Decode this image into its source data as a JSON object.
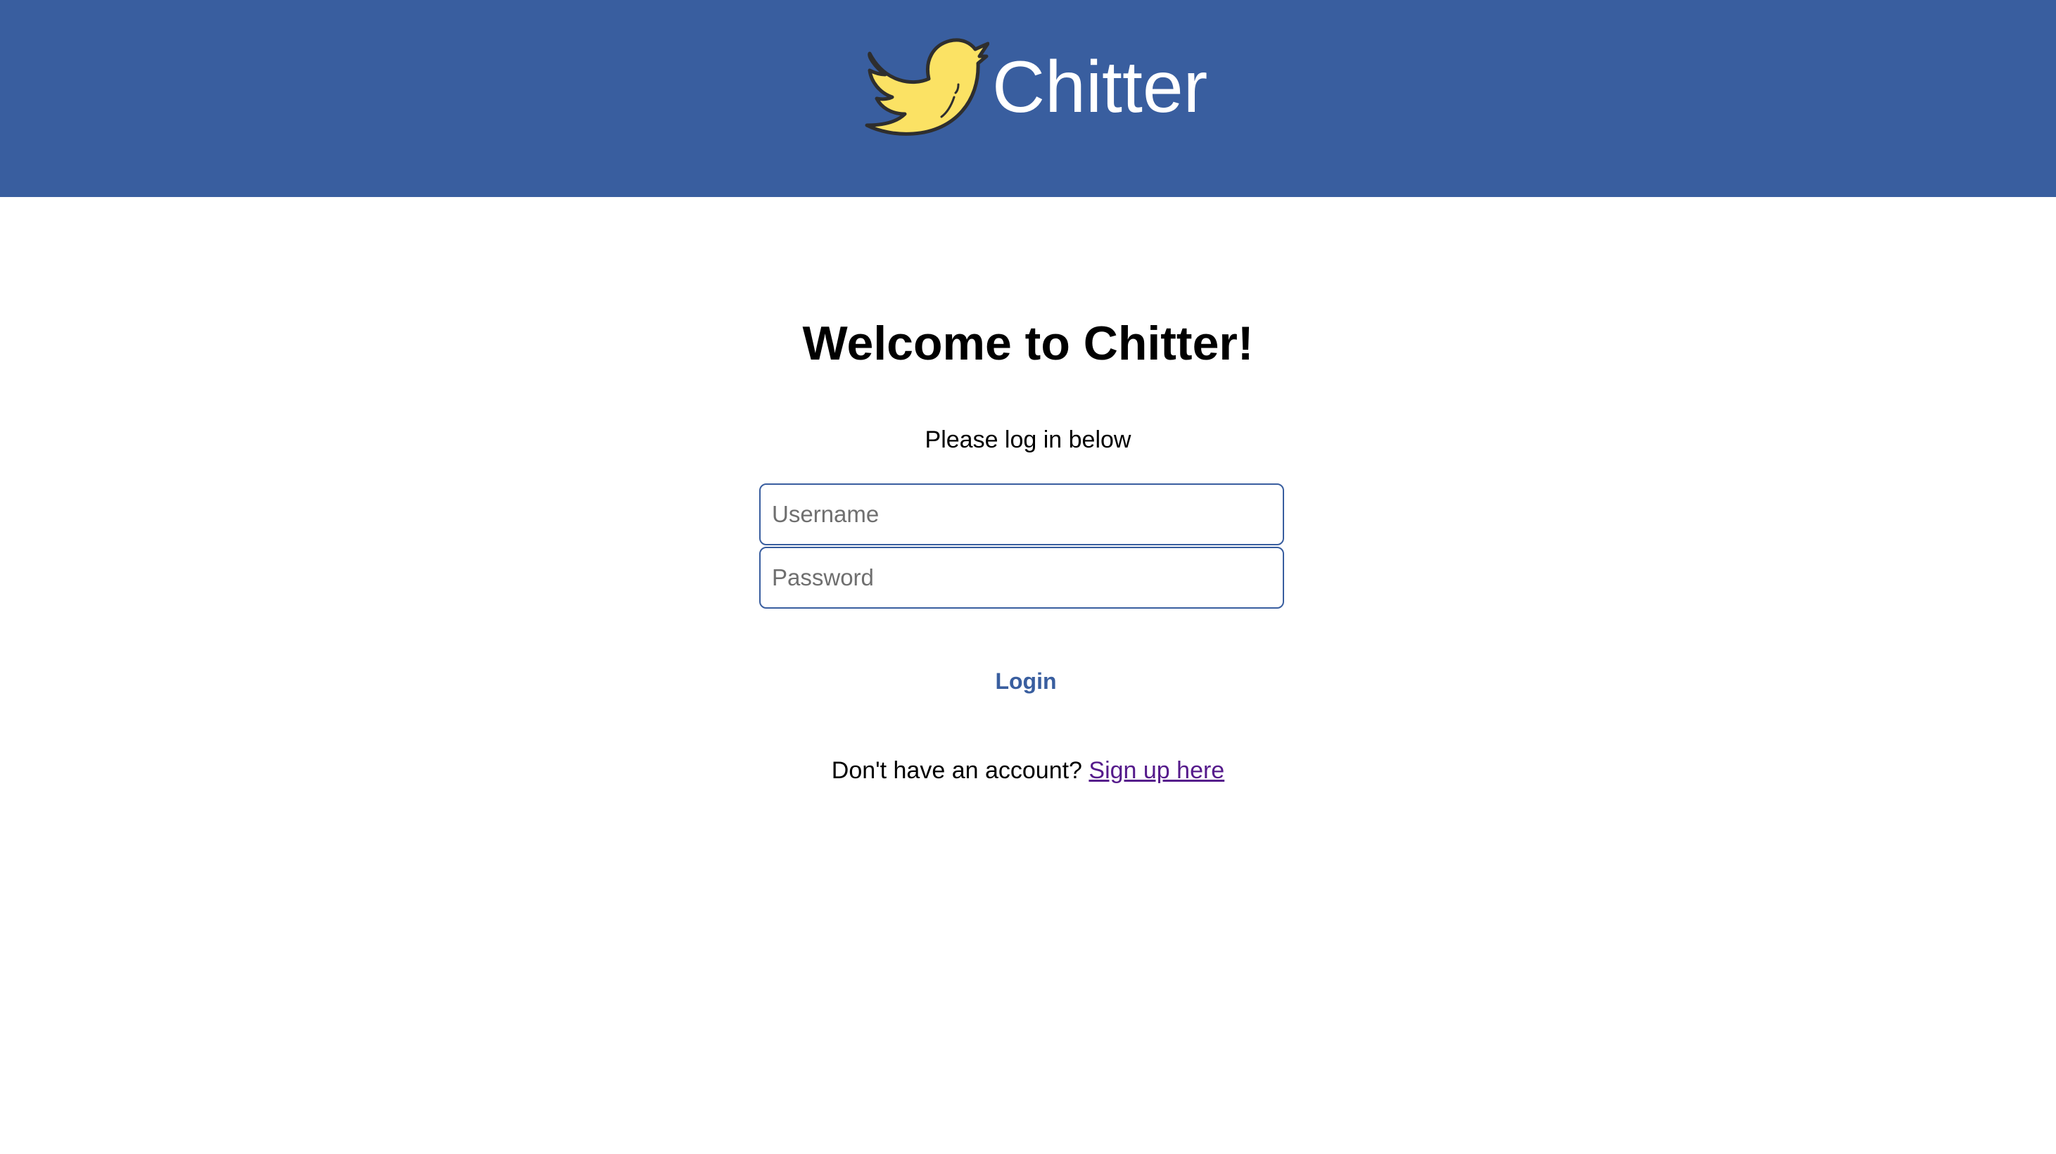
{
  "header": {
    "brand_name": "Chitter",
    "logo_icon": "bird-icon",
    "background_color": "#395e9f",
    "logo_color": "#fbe264"
  },
  "login": {
    "title": "Welcome to Chitter!",
    "subtitle": "Please log in below",
    "username": {
      "placeholder": "Username",
      "value": ""
    },
    "password": {
      "placeholder": "Password",
      "value": ""
    },
    "submit_label": "Login",
    "signup_prompt": "Don't have an account?",
    "signup_link": "Sign up here",
    "accent_color": "#395e9f",
    "link_color": "#551a8b"
  }
}
